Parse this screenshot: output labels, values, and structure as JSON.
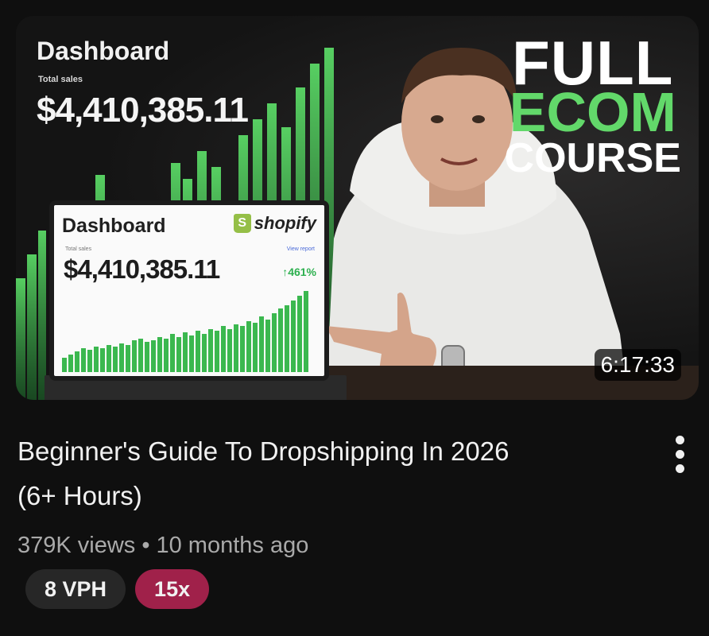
{
  "video": {
    "title_line1": "Beginner's Guide To Dropshipping In 2026",
    "title_line2": "(6+ Hours)",
    "views": "379K views",
    "separator": "•",
    "age": "10 months ago",
    "duration": "6:17:33"
  },
  "thumbnail": {
    "bg_dashboard_title": "Dashboard",
    "bg_total_sales": "Total sales",
    "bg_amount": "$4,410,385.11",
    "headline": [
      "FULL",
      "ECOM",
      "COURSE"
    ],
    "laptop": {
      "title": "Dashboard",
      "brand": "shopify",
      "total_sales": "Total sales",
      "view_report": "View report",
      "amount": "$4,410,385.11",
      "growth": "↑461%"
    }
  },
  "chips": {
    "vph": "8 VPH",
    "multiplier": "15x"
  },
  "colors": {
    "accent_green": "#62d86a",
    "chip_multiplier": "#a0214a",
    "background": "#0f0f0f"
  },
  "icons": {
    "more": "more-vert-icon"
  }
}
